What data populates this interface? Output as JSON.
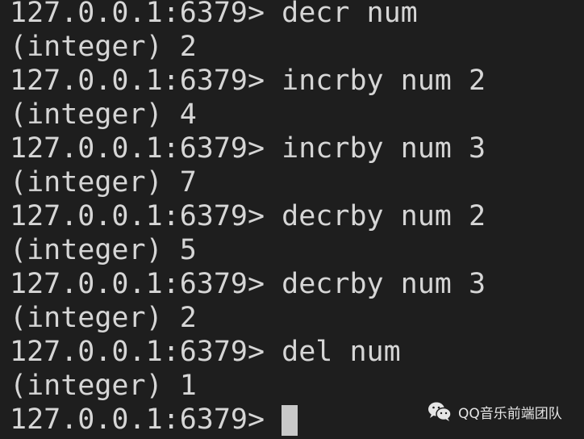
{
  "prompt": "127.0.0.1:6379> ",
  "lines": [
    {
      "type": "cmd",
      "text": "decr num"
    },
    {
      "type": "out",
      "text": "(integer) 2"
    },
    {
      "type": "cmd",
      "text": "incrby num 2"
    },
    {
      "type": "out",
      "text": "(integer) 4"
    },
    {
      "type": "cmd",
      "text": "incrby num 3"
    },
    {
      "type": "out",
      "text": "(integer) 7"
    },
    {
      "type": "cmd",
      "text": "decrby num 2"
    },
    {
      "type": "out",
      "text": "(integer) 5"
    },
    {
      "type": "cmd",
      "text": "decrby num 3"
    },
    {
      "type": "out",
      "text": "(integer) 2"
    },
    {
      "type": "cmd",
      "text": "del num"
    },
    {
      "type": "out",
      "text": "(integer) 1"
    }
  ],
  "watermark": {
    "icon": "wechat-icon",
    "text": "QQ音乐前端团队"
  },
  "colors": {
    "background": "#1e1e1e",
    "text": "#d6d6d6"
  }
}
